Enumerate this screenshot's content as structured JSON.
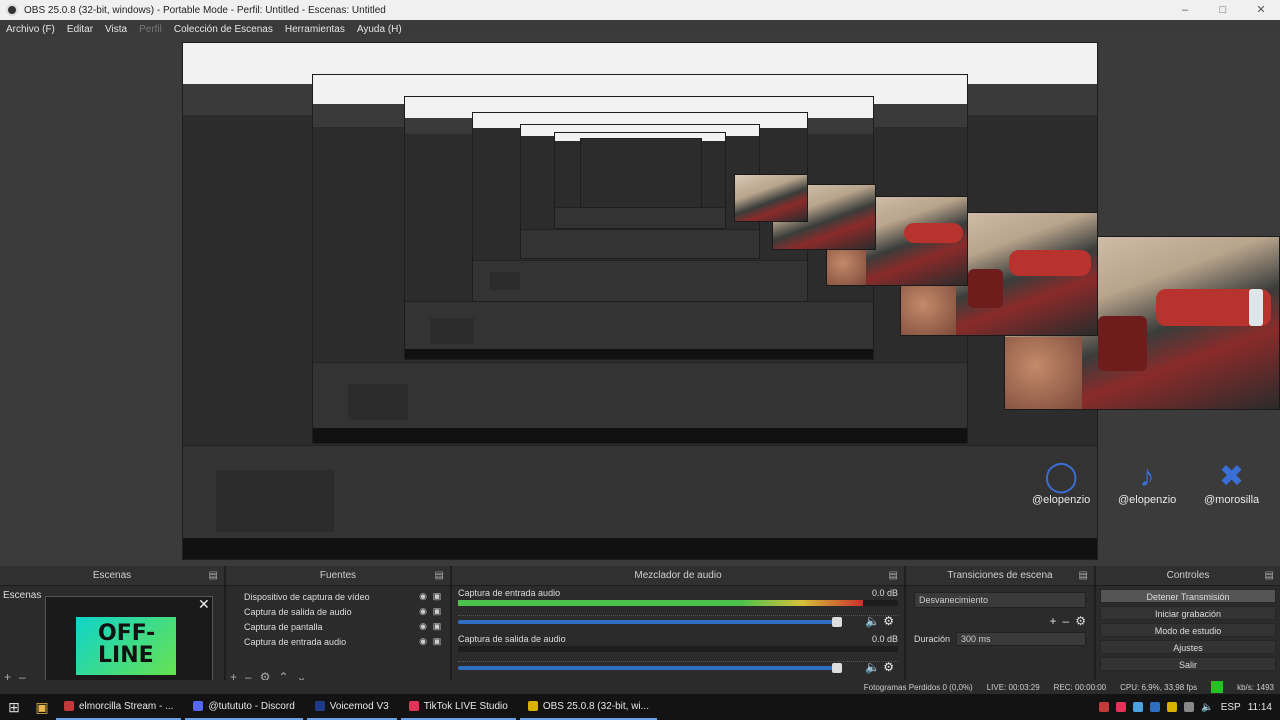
{
  "window": {
    "title": "OBS 25.0.8 (32-bit, windows) - Portable Mode - Perfil: Untitled - Escenas: Untitled"
  },
  "menu": [
    {
      "label": "Archivo (F)",
      "enabled": true
    },
    {
      "label": "Editar",
      "enabled": true
    },
    {
      "label": "Vista",
      "enabled": true
    },
    {
      "label": "Perfil",
      "enabled": false
    },
    {
      "label": "Colección de Escenas",
      "enabled": true
    },
    {
      "label": "Herramientas",
      "enabled": true
    },
    {
      "label": "Ayuda (H)",
      "enabled": true
    }
  ],
  "preview": {
    "social": [
      "@elopenzio",
      "@elopenzio",
      "@morosilla"
    ]
  },
  "scenes_panel": {
    "title": "Escenas",
    "label": "Escenas",
    "thumb_text": "OFF-LINE"
  },
  "sources_panel": {
    "title": "Fuentes",
    "items": [
      "Dispositivo de captura de vídeo",
      "Captura de salida de audio",
      "Captura de pantalla",
      "Captura de entrada audio"
    ]
  },
  "mixer_panel": {
    "title": "Mezclador de audio",
    "channels": [
      {
        "name": "Captura de entrada audio",
        "db": "0.0 dB",
        "level": 0.92
      },
      {
        "name": "Captura de salida de audio",
        "db": "0.0 dB",
        "level": 0.0
      }
    ]
  },
  "transitions_panel": {
    "title": "Transiciones de escena",
    "selected": "Desvanecimiento",
    "duration_label": "Duración",
    "duration_value": "300 ms"
  },
  "controls_panel": {
    "title": "Controles",
    "buttons": [
      "Detener Transmisión",
      "Iniciar grabación",
      "Modo de estudio",
      "Ajustes",
      "Salir"
    ]
  },
  "status": {
    "dropped": "Fotogramas Perdidos 0 (0,0%)",
    "live": "LIVE: 00:03:29",
    "rec": "REC: 00:00:00",
    "cpu": "CPU: 6,9%, 33,98 fps",
    "kbps": "kb/s: 1493"
  },
  "taskbar": {
    "items": [
      {
        "label": "elmorcilla Stream - ...",
        "color": "#c23a3a"
      },
      {
        "label": "@tutututo - Discord",
        "color": "#5865f2"
      },
      {
        "label": "Voicemod V3",
        "color": "#1e3b8a"
      },
      {
        "label": "TikTok LIVE Studio",
        "color": "#e2335b"
      },
      {
        "label": "OBS 25.0.8 (32-bit, wi...",
        "color": "#d9b100"
      }
    ],
    "lang": "ESP",
    "time": "11:14"
  },
  "colors": {
    "accent_blue": "#2e6fc4",
    "meter_green": "#4cc24c",
    "offline_cyan": "#17d1c5",
    "status_green": "#21c421"
  }
}
